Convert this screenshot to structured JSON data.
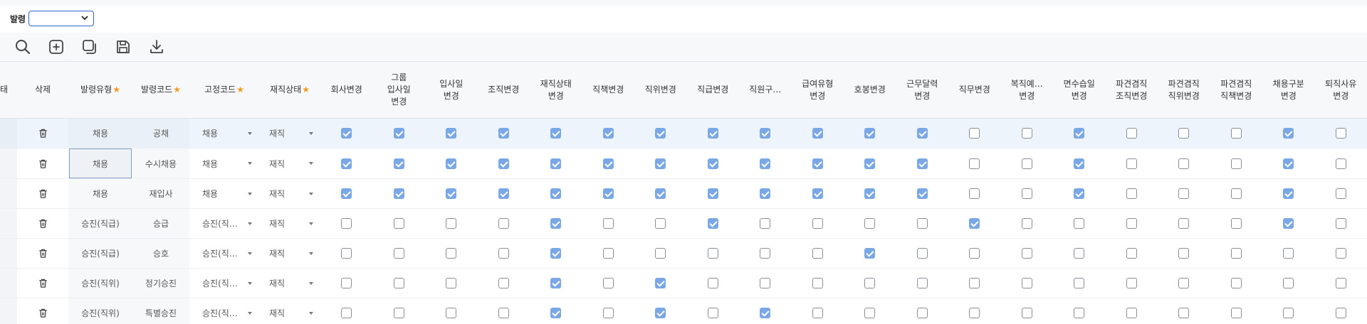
{
  "filter": {
    "label": "발령",
    "value": ""
  },
  "toolbar": {
    "buttons": [
      {
        "name": "search-button",
        "icon": "search-icon"
      },
      {
        "name": "add-button",
        "icon": "plus-square-icon"
      },
      {
        "name": "copy-button",
        "icon": "copy-icon"
      },
      {
        "name": "save-button",
        "icon": "save-icon"
      },
      {
        "name": "download-button",
        "icon": "download-icon"
      }
    ]
  },
  "grid": {
    "columns": {
      "partial": "태",
      "delete": "삭제",
      "order_type": "발령유형",
      "order_code": "발령코드",
      "fixed_code": "고정코드",
      "emp_status": "재직상태",
      "flags": [
        "회사변경",
        "그룹\n입사일\n변경",
        "입사일\n변경",
        "조직변경",
        "재직상태\n변경",
        "직책변경",
        "직위변경",
        "직급변경",
        "직원구…",
        "급여유형\n변경",
        "호봉변경",
        "근무달력\n변경",
        "직무변경",
        "복직예…\n변경",
        "면수습일\n변경",
        "파견겸직\n조직변경",
        "파견겸직\n직위변경",
        "파견겸직\n직책변경",
        "채용구분\n변경",
        "퇴직사유\n변경"
      ]
    },
    "rows": [
      {
        "order_type": "채용",
        "order_code": "공채",
        "fixed_code": "채용",
        "emp_status": "재직",
        "flags": [
          true,
          true,
          true,
          true,
          true,
          true,
          true,
          true,
          true,
          true,
          true,
          true,
          false,
          false,
          true,
          false,
          false,
          false,
          true,
          false
        ]
      },
      {
        "order_type": "채용",
        "order_code": "수시채용",
        "fixed_code": "채용",
        "emp_status": "재직",
        "flags": [
          true,
          true,
          true,
          true,
          true,
          true,
          true,
          true,
          true,
          true,
          true,
          true,
          false,
          false,
          true,
          false,
          false,
          false,
          true,
          false
        ]
      },
      {
        "order_type": "채용",
        "order_code": "재입사",
        "fixed_code": "채용",
        "emp_status": "재직",
        "flags": [
          true,
          true,
          true,
          true,
          true,
          true,
          true,
          true,
          true,
          true,
          true,
          true,
          false,
          false,
          true,
          false,
          false,
          false,
          true,
          false
        ]
      },
      {
        "order_type": "승진(직급)",
        "order_code": "승급",
        "fixed_code": "승진(직…",
        "emp_status": "재직",
        "flags": [
          false,
          false,
          false,
          false,
          true,
          false,
          false,
          true,
          false,
          false,
          false,
          false,
          true,
          false,
          false,
          false,
          false,
          false,
          true,
          false
        ]
      },
      {
        "order_type": "승진(직급)",
        "order_code": "승호",
        "fixed_code": "승진(직…",
        "emp_status": "재직",
        "flags": [
          false,
          false,
          false,
          false,
          true,
          false,
          false,
          false,
          false,
          false,
          true,
          false,
          false,
          false,
          false,
          false,
          false,
          false,
          false,
          false
        ]
      },
      {
        "order_type": "승진(직위)",
        "order_code": "정기승진",
        "fixed_code": "승진(직…",
        "emp_status": "재직",
        "flags": [
          false,
          false,
          false,
          false,
          true,
          false,
          true,
          false,
          false,
          false,
          false,
          false,
          false,
          false,
          false,
          false,
          false,
          false,
          false,
          false
        ]
      },
      {
        "order_type": "승진(직위)",
        "order_code": "특별승진",
        "fixed_code": "승진(직…",
        "emp_status": "재직",
        "flags": [
          false,
          false,
          false,
          false,
          true,
          false,
          true,
          false,
          true,
          false,
          false,
          false,
          false,
          false,
          false,
          false,
          false,
          false,
          false,
          false
        ]
      }
    ]
  },
  "colors": {
    "accent": "#2f63d6",
    "checkbox_on": "#7aa8e6",
    "required_star": "#f29a1f",
    "selected_row": "#eef4fb"
  }
}
